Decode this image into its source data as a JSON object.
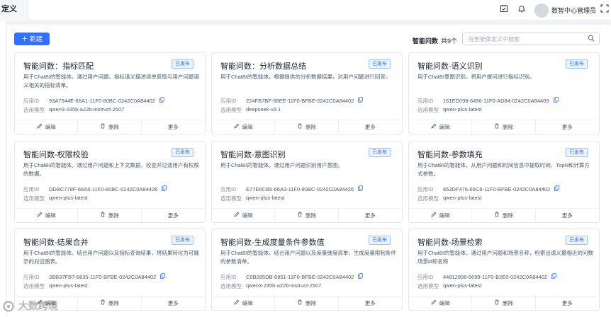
{
  "topbar": {
    "tab_label": "定义",
    "username": "数智中心管理员"
  },
  "toolbar": {
    "new_label": "新建",
    "count_label": "智能问数",
    "count_value": "共9个",
    "search_placeholder": "在智能体定义中搜索"
  },
  "field_labels": {
    "app_id": "应用ID",
    "model": "选用模型"
  },
  "actions": {
    "edit": "编辑",
    "delete": "删除",
    "more": "更多"
  },
  "cards": [
    {
      "title": "智能问数：指标匹配",
      "status": "已发布",
      "description": "用于ChatBI的智能体。通过用户问题、指标语义描述清单获取与用户问题语义相关的指标清单。",
      "app_id": "93A7544E-66A1-11F0-80BC-0242C0A84402",
      "model": "qwen3-235b-a22b-instruct-2507"
    },
    {
      "title": "智能问数：分析数据总结",
      "status": "已发布",
      "description": "用于ChatBI的智能体。根据提供的分析数据结果，对用户问题进行回答。",
      "app_id": "224FB7BF-68EE-11F0-BFBE-0242C0A84402",
      "model": "deepseek-v3.1"
    },
    {
      "title": "智能问数-语义识别",
      "status": "已发布",
      "description": "用于ChatBI意图识别，将用户提问进行指标识别。",
      "app_id": "161ED098-6496-11F0-AD84-0242C0A84409",
      "model": "qwen-plus-latest"
    },
    {
      "title": "智能问数-权限校验",
      "status": "已发布",
      "description": "用于ChatBI的智能体。通过用户问题和上下文数据，校查并过滤用户有权限的数据。",
      "app_id": "DDBC778F-66A6-11F0-80BC-0242C0A84426",
      "model": "qwen-plus-latest"
    },
    {
      "title": "智能问数-意图识别",
      "status": "已发布",
      "description": "用于ChatBI的智能体。通过用户问题识别用户意图。",
      "app_id": "E77E6CB5-66A3-11F0-80BC-0242C0A84426",
      "model": "qwen-plus-latest"
    },
    {
      "title": "智能问数-参数填充",
      "status": "已发布",
      "description": "用于ChatBI的智能体。从用户问题和时间信息中提取时间、TopN和计算方式参数。",
      "app_id": "652DF476-66C8-11F0-BFBE-0242C0A84402",
      "model": "qwen-plus-latest"
    },
    {
      "title": "智能问数-结果合并",
      "status": "已发布",
      "description": "用于ChatBI的智能体。结合用户问题以及指标查询结果，将结果转化为可展示的对应图表。",
      "app_id": "3BB37FB7-6835-11F0-BFBE-0242C0A84402",
      "model": "qwen-plus-latest"
    },
    {
      "title": "智能问数-生成度量条件参数值",
      "status": "已发布",
      "description": "用于ChatBI的智能体。结合用户问题以及度量维度清单，生成度量限制条件的参数清单。",
      "app_id": "C0B285DB-6851-11F0-BFBE-0242C0A84402",
      "model": "qwen3-235b-a22b-instruct-2507"
    },
    {
      "title": "智能问数-场景检索",
      "status": "已发布",
      "description": "用于ChatBI的智能体。通过用户问题和场景名称，检索出语义最相近的问数场景id和名称",
      "app_id": "44812898-6699-11F0-B2E0-0242C0A84402",
      "model": "qwen-plus-latest"
    }
  ],
  "watermark": "大数跨境"
}
